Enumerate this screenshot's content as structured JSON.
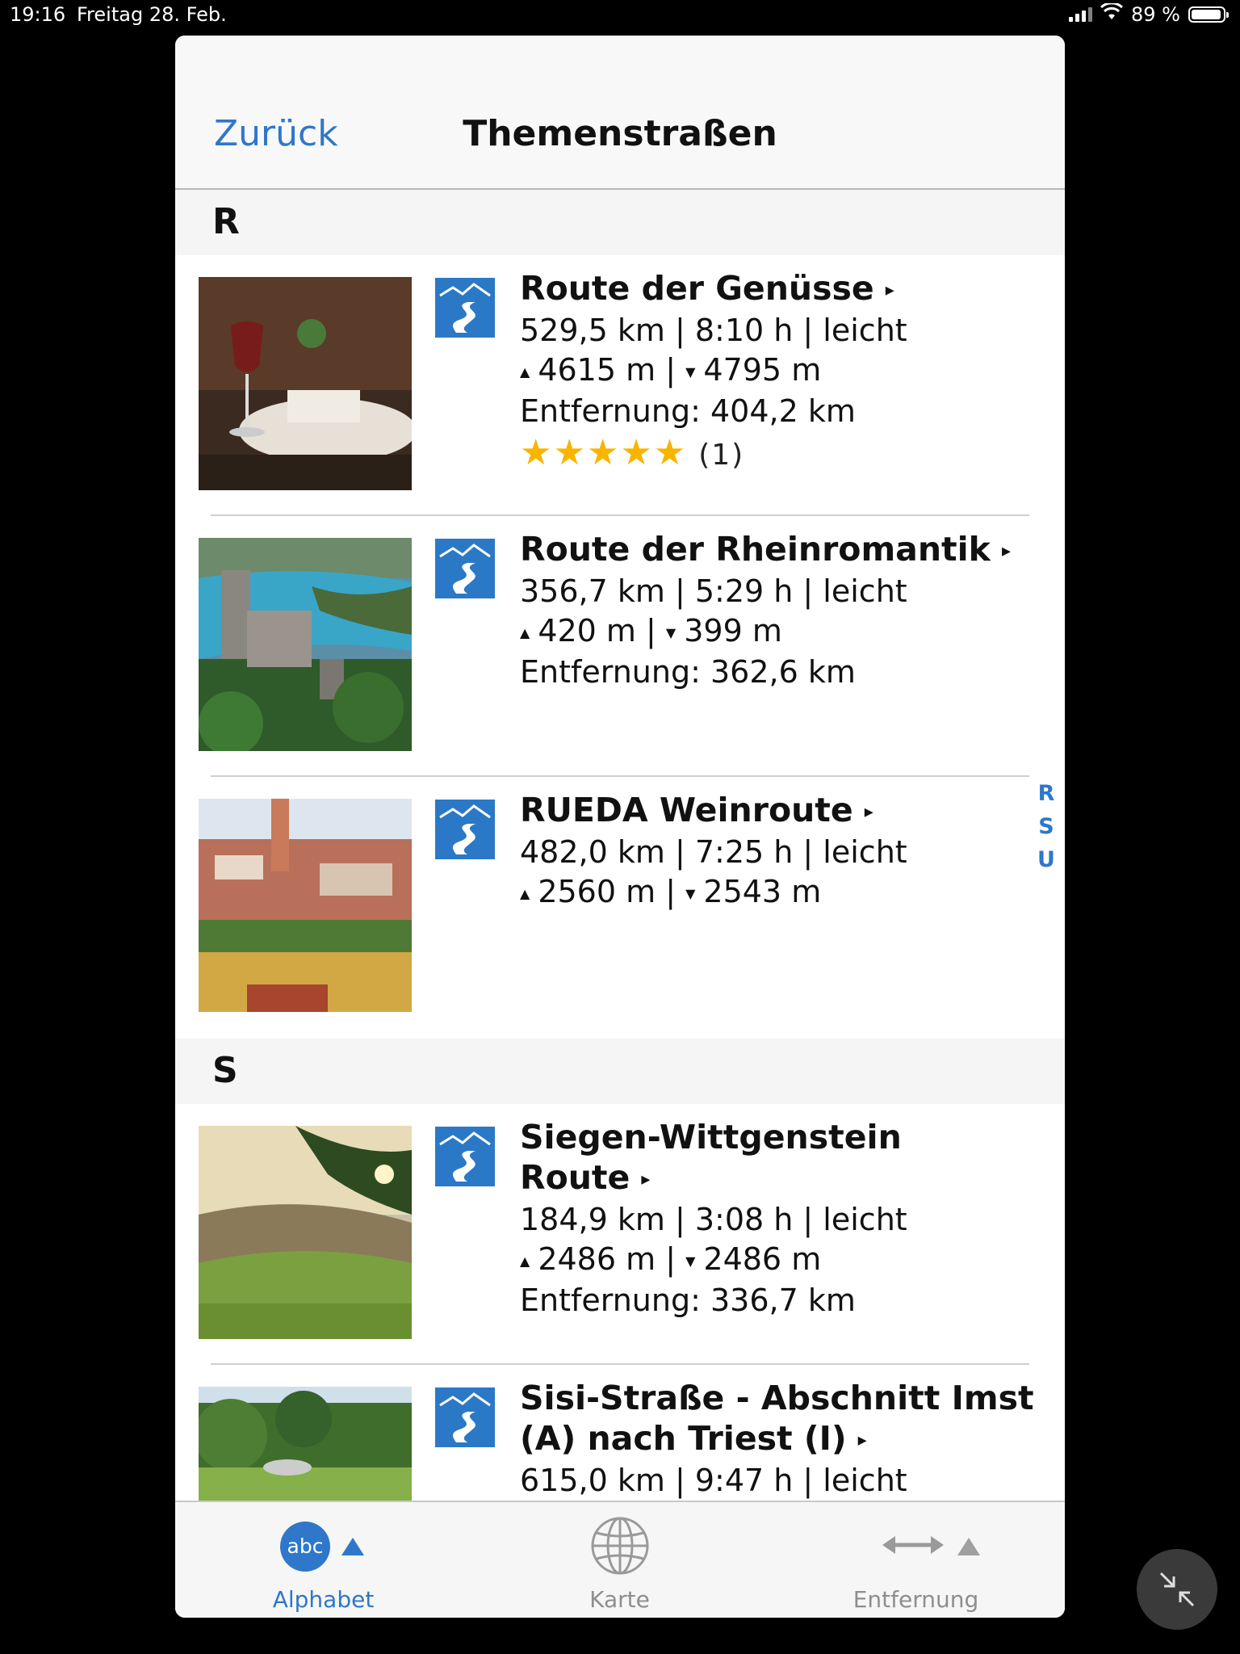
{
  "status": {
    "time": "19:16",
    "date": "Freitag 28. Feb.",
    "battery": "89 %"
  },
  "nav": {
    "back": "Zurück",
    "title": "Themenstraßen"
  },
  "sections": [
    {
      "letter": "R",
      "rows": [
        {
          "title": "Route der Genüsse",
          "arrow": "▸",
          "stats": "529,5 km | 8:10 h | leicht",
          "ascent": "4615 m",
          "descent": "4795 m",
          "distance": "Entfernung: 404,2 km",
          "stars": "★★★★★",
          "rating_count": "(1)"
        },
        {
          "title": "Route der Rheinromantik",
          "arrow": "▸",
          "stats": "356,7 km | 5:29 h | leicht",
          "ascent": "420 m",
          "descent": "399 m",
          "distance": "Entfernung: 362,6 km"
        },
        {
          "title": "RUEDA Weinroute",
          "arrow": "▸",
          "stats": "482,0 km | 7:25 h | leicht",
          "ascent": "2560 m",
          "descent": "2543 m"
        }
      ]
    },
    {
      "letter": "S",
      "rows": [
        {
          "title": "Siegen-Wittgenstein Route",
          "arrow": "▸",
          "stats": "184,9 km | 3:08 h | leicht",
          "ascent": "2486 m",
          "descent": "2486 m",
          "distance": "Entfernung: 336,7 km"
        },
        {
          "title": "Sisi-Straße - Abschnitt Imst (A) nach Triest (I)",
          "arrow": "▸",
          "stats": "615,0 km | 9:47 h | leicht"
        }
      ]
    }
  ],
  "index": [
    "R",
    "S",
    "U"
  ],
  "tabs": {
    "alphabet": "Alphabet",
    "abc": "abc",
    "map": "Karte",
    "distance": "Entfernung"
  },
  "colors": {
    "accent": "#2f77c9",
    "star": "#f7b500",
    "route_icon": "#2b79c6"
  }
}
